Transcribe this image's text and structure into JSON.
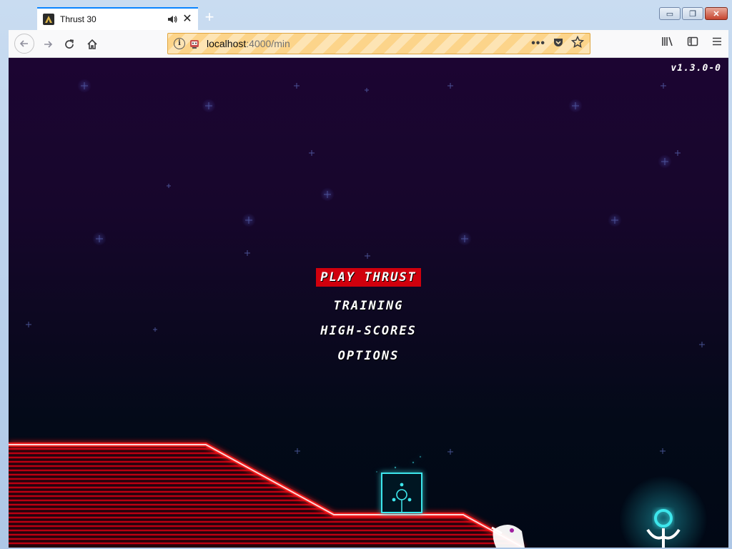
{
  "browser": {
    "tab": {
      "title": "Thrust 30",
      "close_glyph": "✕"
    },
    "new_tab_glyph": "+",
    "window_controls": {
      "minimize": "▭",
      "restore": "❐",
      "close": "✕"
    },
    "url": {
      "host": "localhost",
      "path": ":4000/min"
    },
    "icons": [
      "back-icon",
      "forward-icon",
      "reload-icon",
      "home-icon",
      "info-icon",
      "page-actions-icon",
      "pocket-icon",
      "bookmark-star-icon",
      "library-icon",
      "sidebar-icon",
      "menu-icon"
    ]
  },
  "game": {
    "version": "v1.3.0-0",
    "menu": [
      {
        "label": "PLAY THRUST",
        "selected": true
      },
      {
        "label": "TRAINING",
        "selected": false
      },
      {
        "label": "HIGH-SCORES",
        "selected": false
      },
      {
        "label": "OPTIONS",
        "selected": false
      }
    ],
    "colors": {
      "accent": "#d0000d",
      "terrain_glow": "#ff1010",
      "pod": "#3ee6ec",
      "sky_top": "#1c0532",
      "sky_bottom": "#010815"
    }
  }
}
